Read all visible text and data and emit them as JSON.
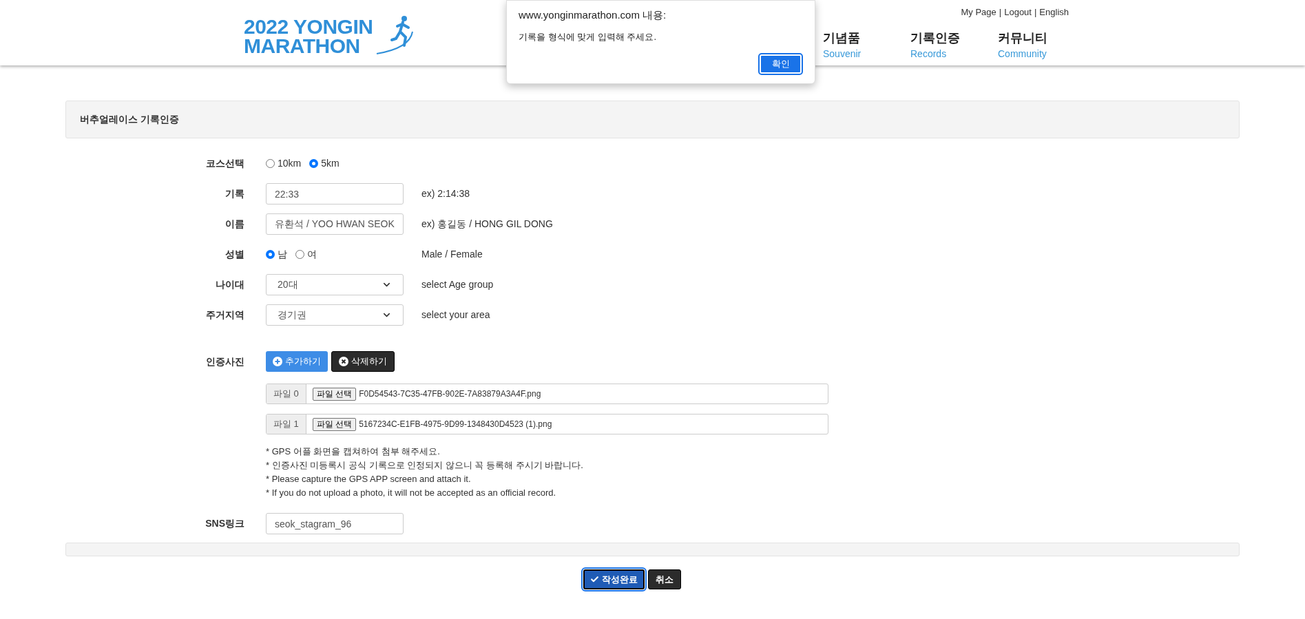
{
  "header": {
    "logo": {
      "line_1": "2022 YONGIN",
      "line_2": "MARATHON"
    },
    "top_links": {
      "separator": "|",
      "items": [
        "My Page",
        "Logout",
        "English"
      ]
    },
    "nav": [
      {
        "label": "기념품",
        "sub": "Souvenir"
      },
      {
        "label": "기록인증",
        "sub": "Records"
      },
      {
        "label": "커뮤니티",
        "sub": "Community"
      }
    ]
  },
  "alert": {
    "origin": "www.yonginmarathon.com 내용:",
    "message": "기록을 형식에 맞게 입력해 주세요.",
    "button": "확인"
  },
  "panel": {
    "title": "버추얼레이스 기록인증"
  },
  "rows": [
    {
      "kind": "radio",
      "label": "코스선택",
      "options": [
        {
          "label": "10km",
          "selected": false
        },
        {
          "label": "5km",
          "selected": true
        }
      ]
    },
    {
      "kind": "input",
      "label": "기록",
      "value": "22:33",
      "hint": "ex) 2:14:38"
    },
    {
      "kind": "input",
      "label": "이름",
      "value": "유환석 / YOO HWAN SEOK",
      "hint": "ex) 홍길동 / HONG GIL DONG"
    },
    {
      "kind": "radio",
      "label": "성별",
      "options": [
        {
          "label": "남",
          "selected": true
        },
        {
          "label": "여",
          "selected": false
        }
      ],
      "hint": "Male / Female"
    },
    {
      "kind": "select",
      "label": "나이대",
      "value": "20대",
      "hint": "select Age group"
    },
    {
      "kind": "select",
      "label": "주거지역",
      "value": "경기권",
      "hint": "select your area"
    }
  ],
  "photos": {
    "label": "인증사진",
    "add_button": "추가하기",
    "delete_button": "삭제하기",
    "files": [
      {
        "tag": "파일 0",
        "button": "파일 선택",
        "filename": "F0D54543-7C35-47FB-902E-7A83879A3A4F.png"
      },
      {
        "tag": "파일 1",
        "button": "파일 선택",
        "filename": "5167234C-E1FB-4975-9D99-1348430D4523 (1).png"
      }
    ],
    "notes": [
      "* GPS 어플 화면을 캡쳐하여 첨부 해주세요.",
      "* 인증사진 미등록시 공식 기록으로 인정되지 않으니 꼭 등록해 주시기 바랍니다.",
      "* Please capture the GPS APP screen and attach it.",
      "* If you do not upload a photo, it will not be accepted as an official record."
    ]
  },
  "sns": {
    "label": "SNS링크",
    "value": "seok_stagram_96"
  },
  "actions": {
    "submit": "작성완료",
    "cancel": "취소"
  }
}
